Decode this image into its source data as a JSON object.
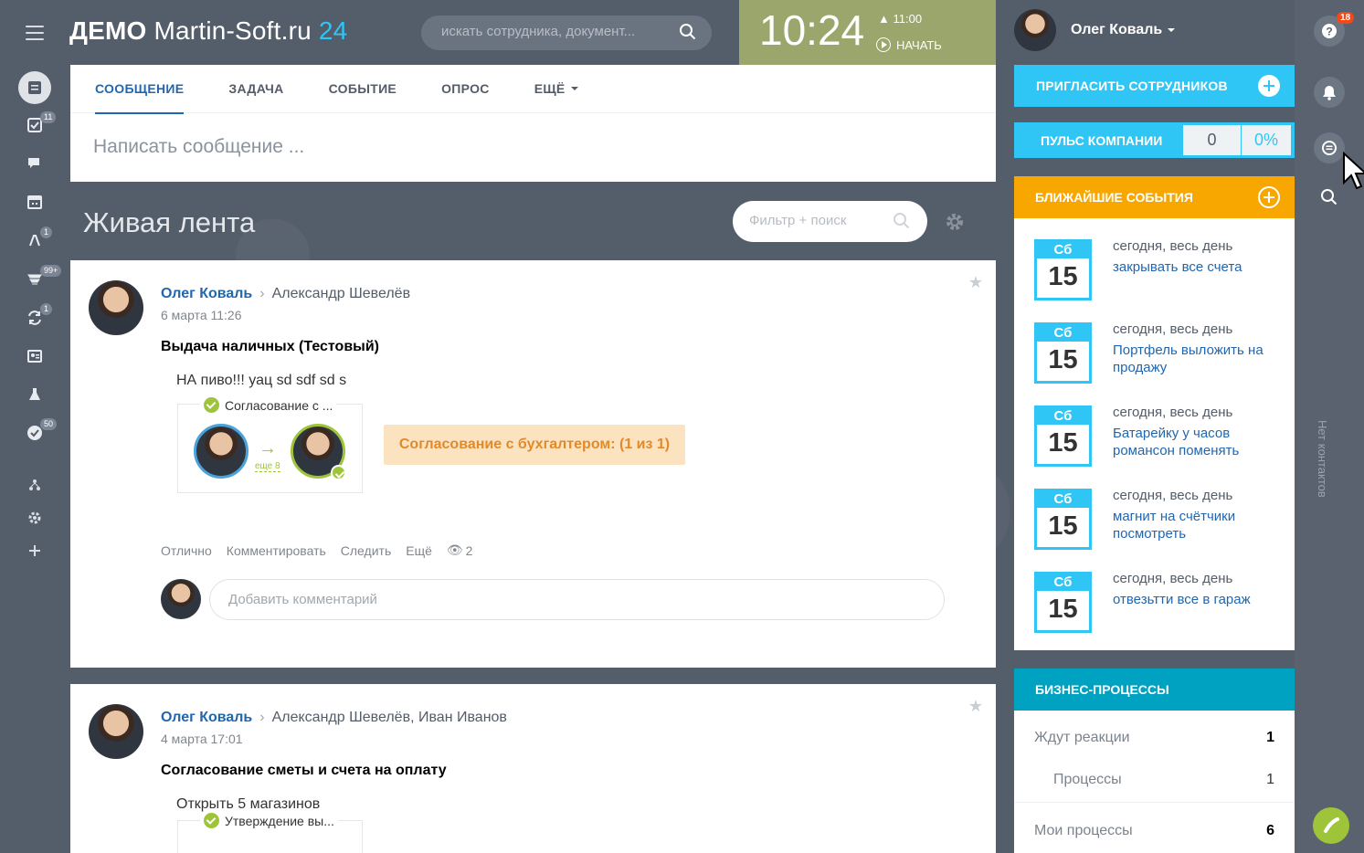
{
  "header": {
    "logo_prefix": "ДЕМО ",
    "logo_brand": "Martin-Soft.ru",
    "logo_num": "24",
    "search_placeholder": "искать сотрудника, документ...",
    "clock_time": "10:24",
    "clock_alarm": "11:00",
    "clock_start": "НАЧАТЬ",
    "user_name": "Олег Коваль"
  },
  "left_rail": {
    "badges": [
      "11",
      "1",
      "99+",
      "1",
      "50"
    ]
  },
  "composer": {
    "tabs": [
      {
        "label": "СООБЩЕНИЕ"
      },
      {
        "label": "ЗАДАЧА"
      },
      {
        "label": "СОБЫТИЕ"
      },
      {
        "label": "ОПРОС"
      },
      {
        "label": "ЕЩЁ"
      }
    ],
    "placeholder": "Написать сообщение ..."
  },
  "feed": {
    "title": "Живая лента",
    "filter_placeholder": "Фильтр + поиск"
  },
  "posts": [
    {
      "author": "Олег Коваль",
      "recipients": "Александр Шевелёв",
      "date": "6 марта 11:26",
      "title": "Выдача наличных (Тестовый)",
      "body": "НА пиво!!! уац sd sdf sd s",
      "bp_title": "Согласование с ...",
      "bp_more": "еще 8",
      "bp_status": "Согласование с бухгалтером: (1 из 1)",
      "actions": [
        "Отлично",
        "Комментировать",
        "Следить",
        "Ещё"
      ],
      "views": "2",
      "comment_placeholder": "Добавить комментарий"
    },
    {
      "author": "Олег Коваль",
      "recipients": "Александр Шевелёв, Иван Иванов",
      "date": "4 марта 17:01",
      "title": "Согласование сметы и счета на оплату",
      "body": "Открыть 5 магазинов",
      "bp_title": "Утверждение вы..."
    }
  ],
  "right": {
    "invite_label": "ПРИГЛАСИТЬ СОТРУДНИКОВ",
    "pulse_label": "ПУЛЬС КОМПАНИИ",
    "pulse_value": "0",
    "pulse_percent": "0%",
    "events_label": "БЛИЖАЙШИЕ СОБЫТИЯ",
    "events": [
      {
        "dow": "Сб",
        "day": "15",
        "when": "сегодня, весь день",
        "what": "закрывать все счета"
      },
      {
        "dow": "Сб",
        "day": "15",
        "when": "сегодня, весь день",
        "what": "Портфель выложить на продажу"
      },
      {
        "dow": "Сб",
        "day": "15",
        "when": "сегодня, весь день",
        "what": "Батарейку у часов романсон поменять"
      },
      {
        "dow": "Сб",
        "day": "15",
        "when": "сегодня, весь день",
        "what": "магнит на счётчики посмотреть"
      },
      {
        "dow": "Сб",
        "day": "15",
        "when": "сегодня, весь день",
        "what": "отвезьтти все в гараж"
      }
    ],
    "bp_label": "БИЗНЕС-ПРОЦЕССЫ",
    "bp_rows": [
      {
        "label": "Ждут реакции",
        "count": "1"
      },
      {
        "label": "Процессы",
        "count": "1"
      },
      {
        "label": "Мои процессы",
        "count": "6"
      }
    ]
  },
  "right_rail": {
    "help_badge": "18",
    "no_contacts": "Нет контактов"
  },
  "colors": {
    "accent": "#2fc6f6",
    "link": "#2067b0",
    "events": "#f7a700",
    "bp": "#00a2c1",
    "clock": "#9aa66b"
  }
}
